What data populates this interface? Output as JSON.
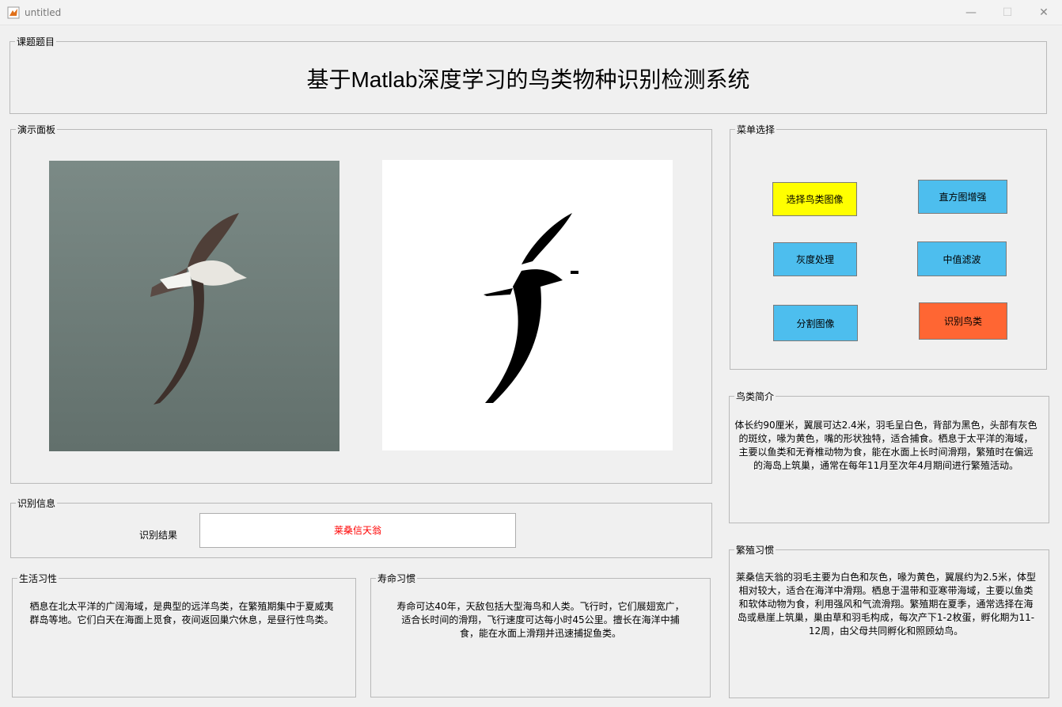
{
  "window": {
    "title": "untitled",
    "minimize": "—",
    "maximize": "☐",
    "close": "✕"
  },
  "title_panel": {
    "label": "课题题目",
    "heading": "基于Matlab深度学习的鸟类物种识别检测系统"
  },
  "demo_panel": {
    "label": "演示面板"
  },
  "menu_panel": {
    "label": "菜单选择",
    "buttons": [
      {
        "label": "选择鸟类图像",
        "color": "#ffff00"
      },
      {
        "label": "直方图增强",
        "color": "#4dbeee"
      },
      {
        "label": "灰度处理",
        "color": "#4dbeee"
      },
      {
        "label": "中值滤波",
        "color": "#4dbeee"
      },
      {
        "label": "分割图像",
        "color": "#4dbeee"
      },
      {
        "label": "识别鸟类",
        "color": "#ff6633"
      }
    ]
  },
  "intro_panel": {
    "label": "鸟类简介",
    "text": "体长约90厘米，翼展可达2.4米，羽毛呈白色，背部为黑色，头部有灰色的斑纹，喙为黄色，嘴的形状独特，适合捕食。栖息于太平洋的海域，主要以鱼类和无脊椎动物为食，能在水面上长时间滑翔，繁殖时在偏远的海岛上筑巢，通常在每年11月至次年4月期间进行繁殖活动。"
  },
  "recognition_panel": {
    "label": "识别信息",
    "result_label": "识别结果",
    "result_value": "莱桑信天翁",
    "result_color": "#ff0000"
  },
  "habits_panel": {
    "label": "生活习性",
    "text": "栖息在北太平洋的广阔海域，是典型的远洋鸟类，在繁殖期集中于夏威夷群岛等地。它们白天在海面上觅食，夜间返回巢穴休息，是昼行性鸟类。"
  },
  "lifespan_panel": {
    "label": "寿命习惯",
    "text": "寿命可达40年，天敌包括大型海鸟和人类。飞行时，它们展翅宽广，适合长时间的滑翔，飞行速度可达每小时45公里。擅长在海洋中捕食，能在水面上滑翔并迅速捕捉鱼类。"
  },
  "breeding_panel": {
    "label": "繁殖习惯",
    "text": "莱桑信天翁的羽毛主要为白色和灰色，喙为黄色，翼展约为2.5米，体型相对较大，适合在海洋中滑翔。栖息于温带和亚寒带海域，主要以鱼类和软体动物为食，利用强风和气流滑翔。繁殖期在夏季，通常选择在海岛或悬崖上筑巢，巢由草和羽毛构成，每次产下1-2枚蛋，孵化期为11-12周，由父母共同孵化和照顾幼鸟。"
  }
}
